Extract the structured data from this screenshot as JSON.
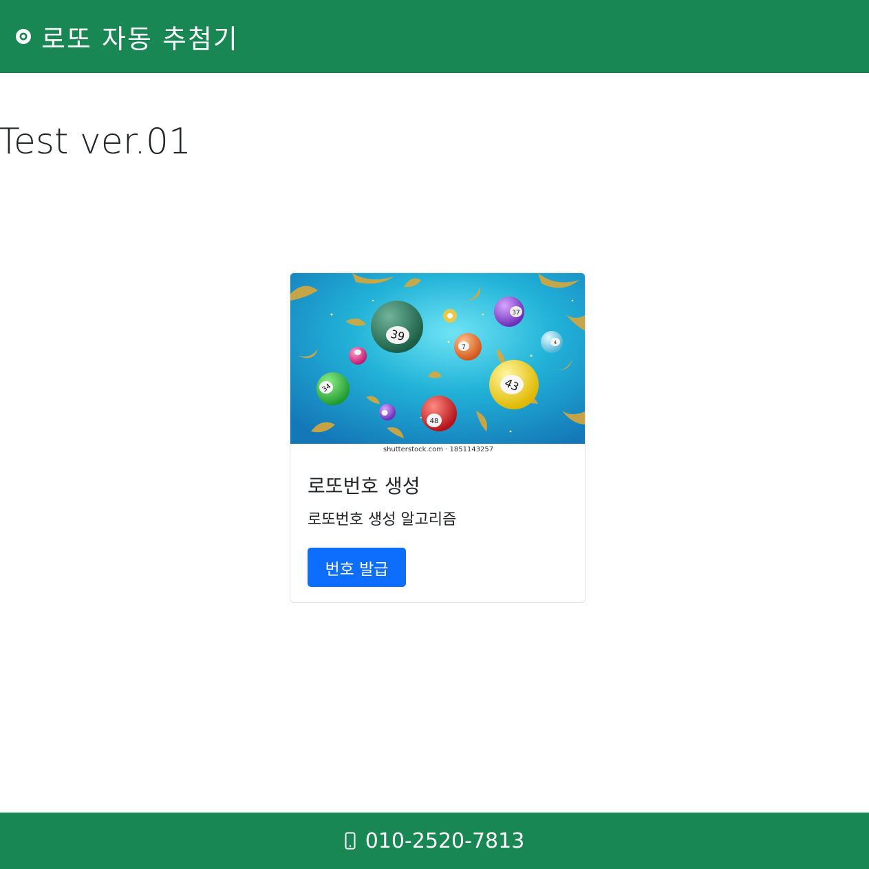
{
  "navbar": {
    "brand_text": "로또 자동 추첨기",
    "brand_icon": "record-circle-icon",
    "background": "#198754"
  },
  "main": {
    "version_title": "Test ver.01"
  },
  "card": {
    "image_caption": "shutterstock.com · 1851143257",
    "title": "로또번호 생성",
    "text": "로또번호 생성 알고리즘",
    "button_label": "번호 발급",
    "button_color": "#0d6efd"
  },
  "footer": {
    "phone_icon": "phone-icon",
    "phone_number": "010-2520-7813"
  }
}
